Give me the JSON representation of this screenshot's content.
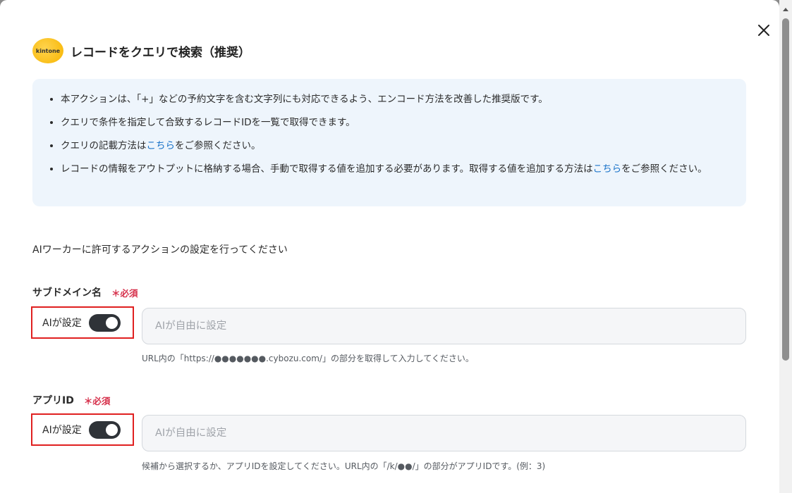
{
  "dialog": {
    "title": "レコードをクエリで検索（推奨）",
    "logo_text": "kintone",
    "close_icon": "close-icon"
  },
  "info": {
    "item1": "本アクションは、「+」などの予約文字を含む文字列にも対応できるよう、エンコード方法を改善した推奨版です。",
    "item2": "クエリで条件を指定して合致するレコードIDを一覧で取得できます。",
    "item3_prefix": "クエリの記載方法は",
    "item3_link": "こちら",
    "item3_suffix": "をご参照ください。",
    "item4_prefix": "レコードの情報をアウトプットに格納する場合、手動で取得する値を追加する必要があります。取得する値を追加する方法は",
    "item4_link": "こちら",
    "item4_suffix": "をご参照ください。"
  },
  "instruction": "AIワーカーに許可するアクションの設定を行ってください",
  "fields": {
    "subdomain": {
      "label": "サブドメイン名",
      "required": "＊必須",
      "ai_label": "AIが設定",
      "ai_enabled": true,
      "placeholder": "AIが自由に設定",
      "help": "URL内の「https://●●●●●●●.cybozu.com/」の部分を取得して入力してください。"
    },
    "app_id": {
      "label": "アプリID",
      "required": "＊必須",
      "ai_label": "AIが設定",
      "ai_enabled": true,
      "placeholder": "AIが自由に設定",
      "help": "候補から選択するか、アプリIDを設定してください。URL内の「/k/●●/」の部分がアプリIDです。(例：3)"
    }
  },
  "colors": {
    "info_bg": "#eef5fc",
    "link": "#1a73c9",
    "required": "#d6304b",
    "highlight": "#e02020",
    "toggle_on": "#2f3338"
  }
}
